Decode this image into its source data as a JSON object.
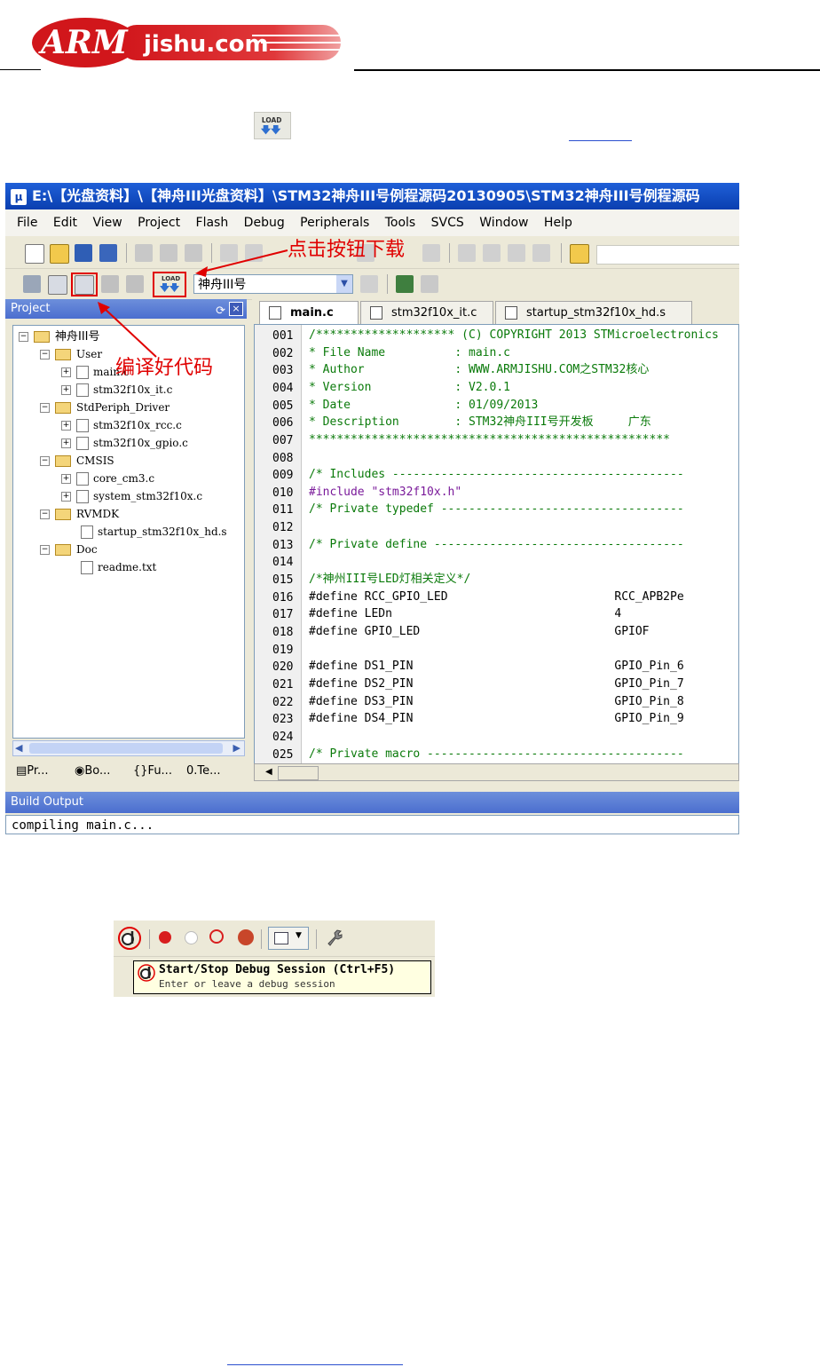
{
  "logo": {
    "text": "ARMjishu.com"
  },
  "ide": {
    "title": "E:\\【光盘资料】\\【神舟III光盘资料】\\STM32神舟III号例程源码20130905\\STM32神舟III号例程源码",
    "menu": [
      "File",
      "Edit",
      "View",
      "Project",
      "Flash",
      "Debug",
      "Peripherals",
      "Tools",
      "SVCS",
      "Window",
      "Help"
    ],
    "target": "神舟III号",
    "project_pane": {
      "title": "Project",
      "tree": [
        {
          "label": "神舟III号",
          "type": "root"
        },
        {
          "label": "User",
          "type": "folder"
        },
        {
          "label": "main.c",
          "type": "file"
        },
        {
          "label": "stm32f10x_it.c",
          "type": "file"
        },
        {
          "label": "StdPeriph_Driver",
          "type": "folder"
        },
        {
          "label": "stm32f10x_rcc.c",
          "type": "file"
        },
        {
          "label": "stm32f10x_gpio.c",
          "type": "file"
        },
        {
          "label": "CMSIS",
          "type": "folder"
        },
        {
          "label": "core_cm3.c",
          "type": "file"
        },
        {
          "label": "system_stm32f10x.c",
          "type": "file"
        },
        {
          "label": "RVMDK",
          "type": "folder"
        },
        {
          "label": "startup_stm32f10x_hd.s",
          "type": "file"
        },
        {
          "label": "Doc",
          "type": "folder"
        },
        {
          "label": "readme.txt",
          "type": "file"
        }
      ],
      "tabs": [
        "Pr...",
        "Bo...",
        "Fu...",
        "Te..."
      ]
    },
    "editor_tabs": [
      "main.c",
      "stm32f10x_it.c",
      "startup_stm32f10x_hd.s"
    ],
    "code_lines": [
      {
        "n": "001",
        "text": "/******************** (C) COPYRIGHT 2013 STMicroelectronics"
      },
      {
        "n": "002",
        "text": "* File Name          : main.c"
      },
      {
        "n": "003",
        "text": "* Author             : WWW.ARMJISHU.COM之STM32核心"
      },
      {
        "n": "004",
        "text": "* Version            : V2.0.1"
      },
      {
        "n": "005",
        "text": "* Date               : 01/09/2013"
      },
      {
        "n": "006",
        "text": "* Description        : STM32神舟III号开发板     广东"
      },
      {
        "n": "007",
        "text": "****************************************************"
      },
      {
        "n": "008",
        "text": ""
      },
      {
        "n": "009",
        "text": "/* Includes ------------------------------------------"
      },
      {
        "n": "010",
        "text": "#include \"stm32f10x.h\""
      },
      {
        "n": "011",
        "text": "/* Private typedef -----------------------------------"
      },
      {
        "n": "012",
        "text": ""
      },
      {
        "n": "013",
        "text": "/* Private define ------------------------------------"
      },
      {
        "n": "014",
        "text": ""
      },
      {
        "n": "015",
        "text": "/*神州III号LED灯相关定义*/"
      },
      {
        "n": "016",
        "text": "#define RCC_GPIO_LED                        RCC_APB2Pe"
      },
      {
        "n": "017",
        "text": "#define LEDn                                4"
      },
      {
        "n": "018",
        "text": "#define GPIO_LED                            GPIOF"
      },
      {
        "n": "019",
        "text": ""
      },
      {
        "n": "020",
        "text": "#define DS1_PIN                             GPIO_Pin_6"
      },
      {
        "n": "021",
        "text": "#define DS2_PIN                             GPIO_Pin_7"
      },
      {
        "n": "022",
        "text": "#define DS3_PIN                             GPIO_Pin_8"
      },
      {
        "n": "023",
        "text": "#define DS4_PIN                             GPIO_Pin_9"
      },
      {
        "n": "024",
        "text": ""
      },
      {
        "n": "025",
        "text": "/* Private macro -------------------------------------"
      }
    ],
    "build_output": {
      "title": "Build Output",
      "text": "compiling main.c..."
    }
  },
  "annotations": {
    "download": "点击按钮下载",
    "compile": "编译好代码"
  },
  "debug_toolbar": {
    "tooltip_title": "Start/Stop Debug Session  (Ctrl+F5)",
    "tooltip_desc": "Enter or leave a debug session"
  },
  "colors": {
    "title_blue": "#0a3fb0",
    "pane_header": "#5a7ed6",
    "annotation_red": "#e00000",
    "comment_green": "#0a7a0a"
  }
}
